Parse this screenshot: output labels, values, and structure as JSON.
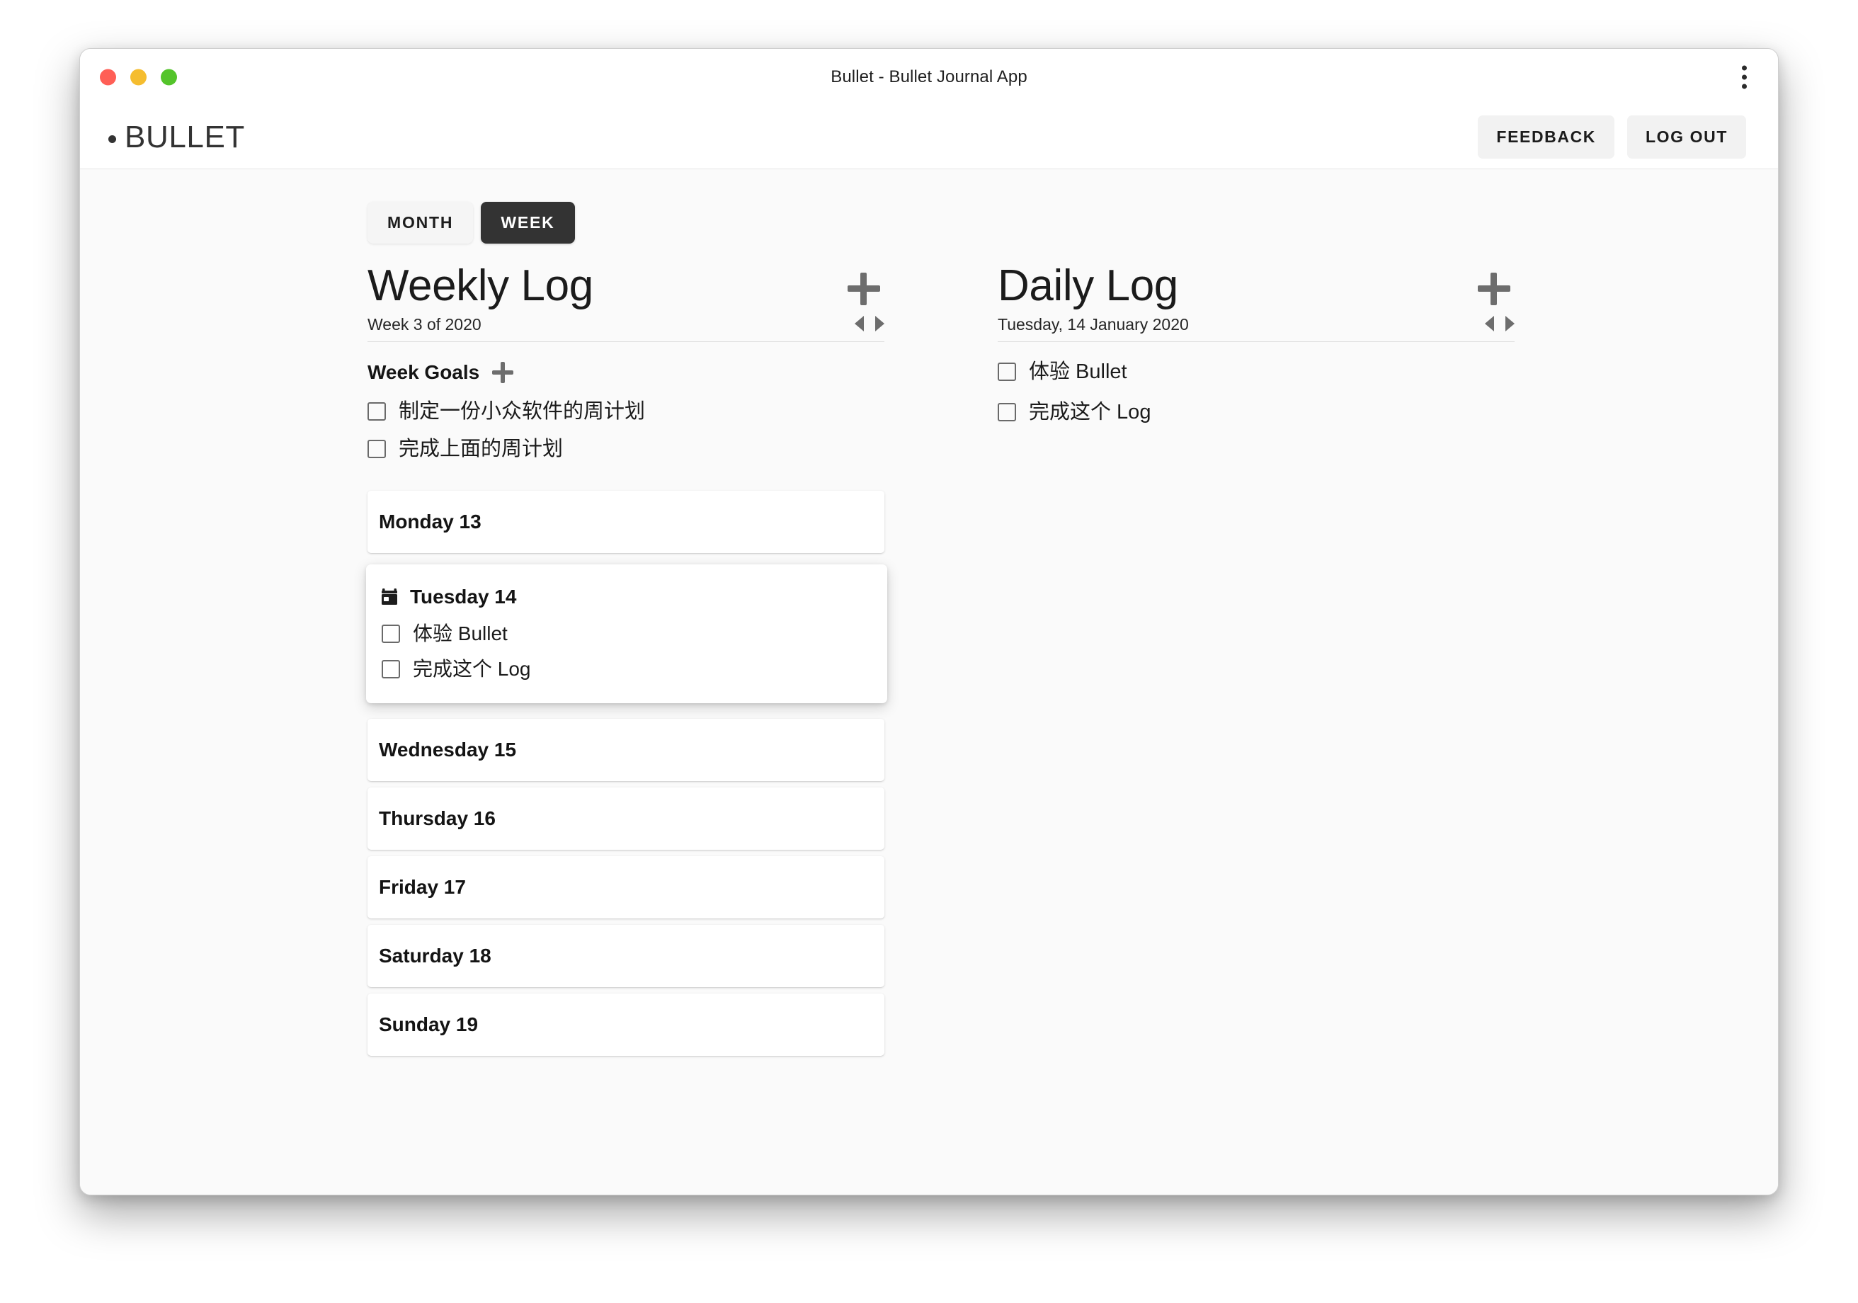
{
  "window": {
    "title": "Bullet - Bullet Journal App",
    "traffic_lights": [
      "close-red",
      "minimize-yellow",
      "maximize-green"
    ],
    "menu_icon": "kebab-menu-icon",
    "colors": {
      "red": "#ff5f56",
      "yellow": "#f5bd2f",
      "green": "#54c42b",
      "accent_dark": "#333333",
      "page_bg": "#fafafa"
    }
  },
  "appbar": {
    "logo": "BULLET",
    "logo_dot": "bullet-dot-icon",
    "feedback_label": "FEEDBACK",
    "logout_label": "LOG OUT"
  },
  "view_toggle": {
    "month_label": "MONTH",
    "week_label": "WEEK",
    "active": "WEEK"
  },
  "weekly": {
    "title": "Weekly Log",
    "subtitle": "Week 3 of 2020",
    "add_icon": "plus-icon",
    "prev_icon": "chevron-left-icon",
    "next_icon": "chevron-right-icon",
    "goals_title": "Week Goals",
    "goals_add_icon": "plus-icon",
    "goals": [
      {
        "label": "制定一份小众软件的周计划",
        "checked": false
      },
      {
        "label": "完成上面的周计划",
        "checked": false
      }
    ],
    "days": [
      {
        "name": "Monday 13",
        "active": false,
        "tasks": []
      },
      {
        "name": "Tuesday 14",
        "active": true,
        "icon": "calendar-icon",
        "tasks": [
          {
            "label": "体验 Bullet",
            "checked": false
          },
          {
            "label": "完成这个 Log",
            "checked": false
          }
        ]
      },
      {
        "name": "Wednesday 15",
        "active": false,
        "tasks": []
      },
      {
        "name": "Thursday 16",
        "active": false,
        "tasks": []
      },
      {
        "name": "Friday 17",
        "active": false,
        "tasks": []
      },
      {
        "name": "Saturday 18",
        "active": false,
        "tasks": []
      },
      {
        "name": "Sunday 19",
        "active": false,
        "tasks": []
      }
    ]
  },
  "daily": {
    "title": "Daily Log",
    "subtitle": "Tuesday, 14 January 2020",
    "add_icon": "plus-icon",
    "prev_icon": "chevron-left-icon",
    "next_icon": "chevron-right-icon",
    "tasks": [
      {
        "label": "体验 Bullet",
        "checked": false
      },
      {
        "label": "完成这个 Log",
        "checked": false
      }
    ]
  }
}
